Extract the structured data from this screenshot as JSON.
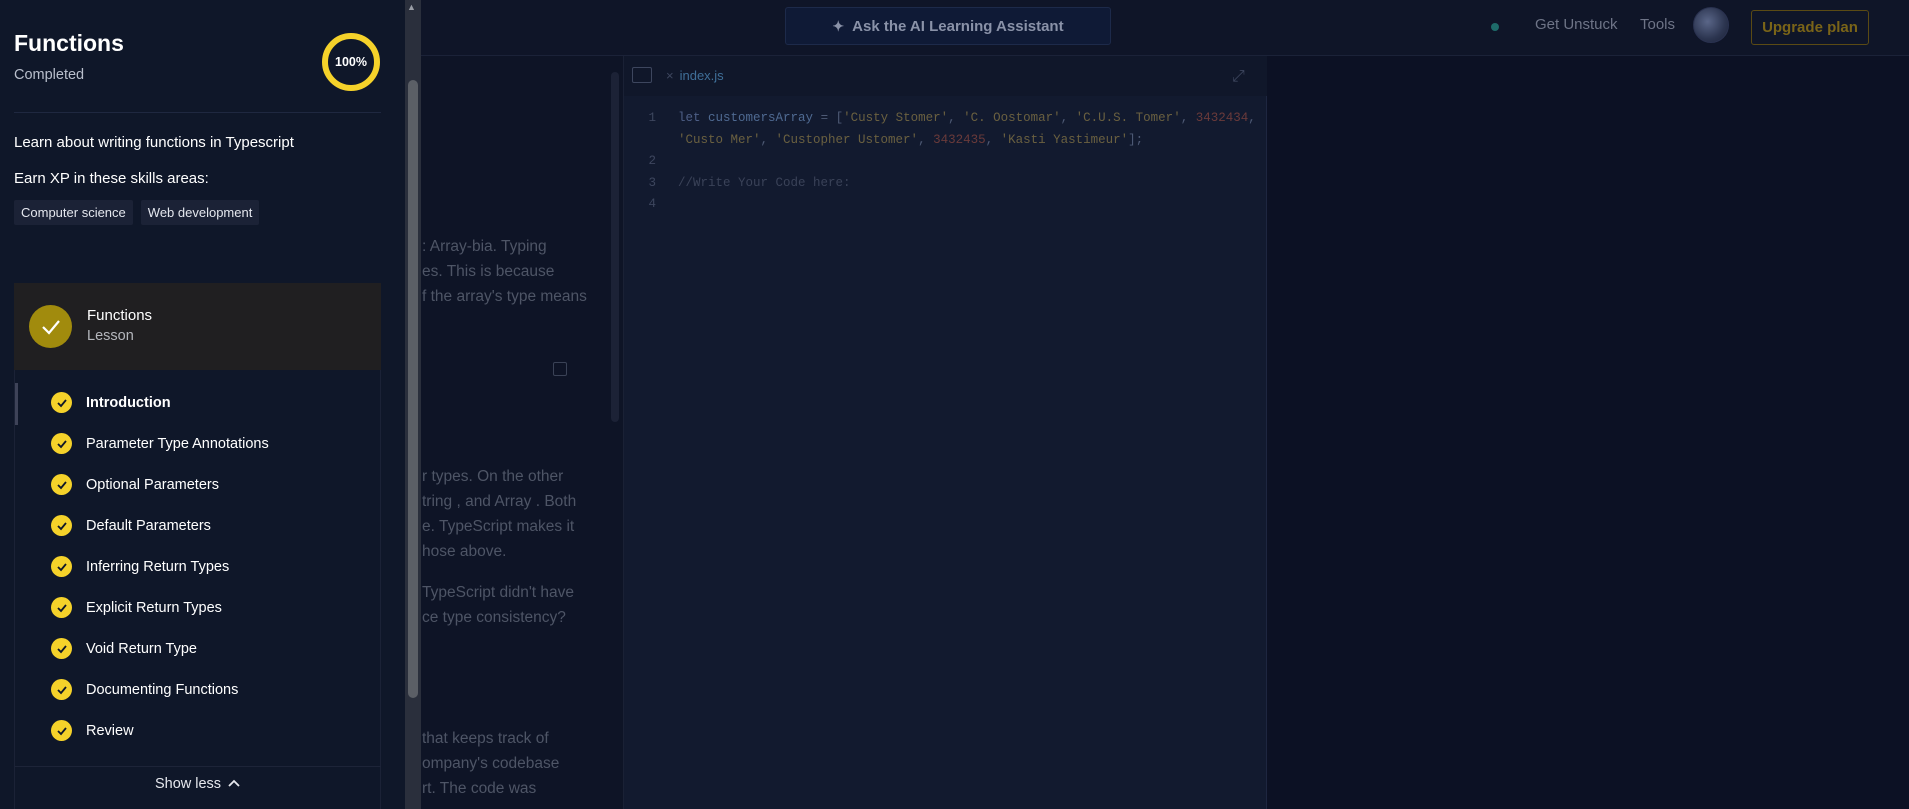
{
  "topbar": {
    "ai_button_label": "Ask the AI Learning Assistant",
    "get_unstuck": "Get Unstuck",
    "tools": "Tools",
    "upgrade": "Upgrade plan"
  },
  "lesson_panel": {
    "lines": [
      ": Array-bia. Typing",
      "es. This is because",
      "f the array's type means",
      "r  types. On the other",
      "tring , and  Array . Both",
      "e. TypeScript makes it",
      "hose above.",
      "TypeScript didn't have",
      "ce type consistency?",
      "that keeps track of",
      "ompany's codebase",
      "rt. The code was"
    ]
  },
  "editor": {
    "tab_name": "index.js",
    "line_numbers": [
      "1",
      "2",
      "3",
      "4"
    ],
    "code": {
      "l1_kw": "let",
      "l1_var": "customersArray",
      "l1_eq": " = [",
      "s1": "'Custy Stomer'",
      "s2": "'C. Oostomar'",
      "s3": "'C.U.S. Tomer'",
      "n1": "3432434",
      "s4": "'Custo Mer'",
      "s5": "'Custopher Ustomer'",
      "n2": "3432435",
      "s6": "'Kasti Yastimeur'",
      "end": "];",
      "comment": "//Write Your Code here:"
    }
  },
  "sidebar": {
    "title": "Functions",
    "subtitle": "Completed",
    "progress_label": "100%",
    "progress_value": 1.0,
    "description": "Learn about writing functions in Typescript",
    "earn_xp": "Earn XP in these skills areas:",
    "skills": [
      "Computer science",
      "Web development"
    ],
    "lesson": {
      "title": "Functions",
      "type": "Lesson"
    },
    "steps": [
      "Introduction",
      "Parameter Type Annotations",
      "Optional Parameters",
      "Default Parameters",
      "Inferring Return Types",
      "Explicit Return Types",
      "Void Return Type",
      "Documenting Functions",
      "Review"
    ],
    "show_less": "Show less"
  },
  "colors": {
    "accent_yellow": "#f5d22a",
    "sidebar_bg": "#0f1729"
  }
}
